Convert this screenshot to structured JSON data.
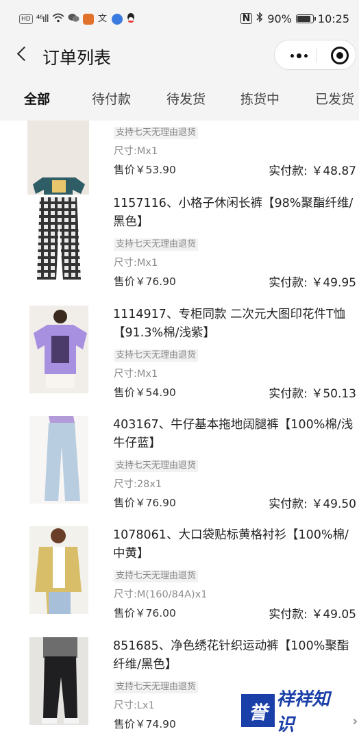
{
  "status_bar": {
    "hd": "HD",
    "signal": "⁴⁶ıll",
    "battery_text": "90%",
    "battery_level": 0.9,
    "time": "10:25",
    "nfc": "N"
  },
  "nav": {
    "title": "订单列表"
  },
  "tabs": [
    {
      "label": "全部",
      "active": true
    },
    {
      "label": "待付款",
      "active": false
    },
    {
      "label": "待发货",
      "active": false
    },
    {
      "label": "拣货中",
      "active": false
    },
    {
      "label": "已发货",
      "active": false
    }
  ],
  "items": [
    {
      "title": "",
      "policy": "支持七天无理由退货",
      "spec": "尺寸:Mx1",
      "price": "售价￥53.90",
      "paid": "实付款: ￥48.87"
    },
    {
      "title": "1157116、小格子休闲长裤【98%聚酯纤维/黑色】",
      "policy": "支持七天无理由退货",
      "spec": "尺寸:Mx1",
      "price": "售价￥76.90",
      "paid": "实付款: ￥49.95"
    },
    {
      "title": "1114917、专柜同款 二次元大图印花件T恤【91.3%棉/浅紫】",
      "policy": "支持七天无理由退货",
      "spec": "尺寸:Mx1",
      "price": "售价￥54.90",
      "paid": "实付款: ￥50.13"
    },
    {
      "title": "403167、牛仔基本拖地阔腿裤【100%棉/浅牛仔蓝】",
      "policy": "支持七天无理由退货",
      "spec": "尺寸:28x1",
      "price": "售价￥76.90",
      "paid": "实付款: ￥49.50"
    },
    {
      "title": "1078061、大口袋贴标黄格衬衫【100%棉/中黄】",
      "policy": "支持七天无理由退货",
      "spec": "尺寸:M(160/84A)x1",
      "price": "售价￥76.00",
      "paid": "实付款: ￥49.05"
    },
    {
      "title": "851685、净色绣花针织运动裤【100%聚酯纤维/黑色】",
      "policy": "支持七天无理由退货",
      "spec": "尺寸:Lx1",
      "price": "售价￥74.90",
      "paid": ""
    }
  ],
  "watermark": {
    "logo": "誉",
    "text": "祥祥知识"
  },
  "colors": {
    "brand_blue": "#1b3fa8",
    "muted_text": "#8c8c8c"
  }
}
